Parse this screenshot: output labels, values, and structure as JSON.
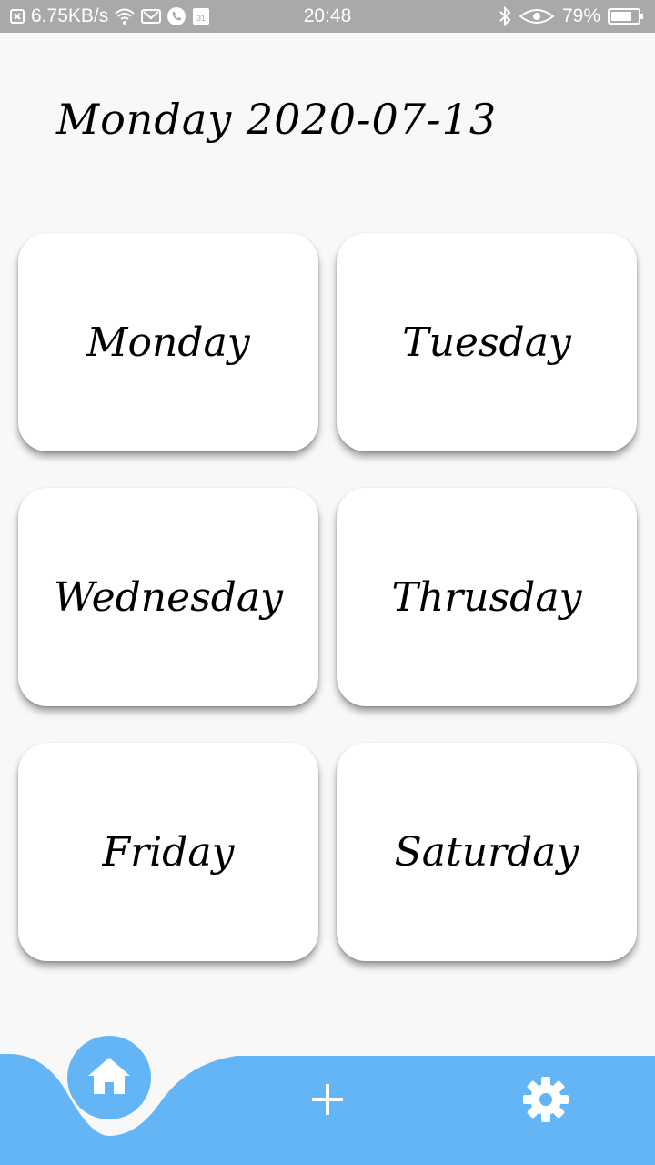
{
  "status_bar": {
    "net_speed": "6.75KB/s",
    "time": "20:48",
    "battery": "79%",
    "calendar_day": "31",
    "icons": [
      "notification-x-icon",
      "wifi-icon",
      "gmail-icon",
      "phone-icon",
      "calendar-icon",
      "bluetooth-icon",
      "eye-icon",
      "battery-icon"
    ]
  },
  "header": {
    "title": "Monday 2020-07-13"
  },
  "days": [
    {
      "label": "Monday"
    },
    {
      "label": "Tuesday"
    },
    {
      "label": "Wednesday"
    },
    {
      "label": "Thrusday"
    },
    {
      "label": "Friday"
    },
    {
      "label": "Saturday"
    }
  ],
  "bottom_nav": {
    "accent_color": "#64b5f6",
    "items": [
      {
        "icon": "home-icon",
        "active": true
      },
      {
        "icon": "plus-icon",
        "active": false
      },
      {
        "icon": "gear-icon",
        "active": false
      }
    ]
  }
}
